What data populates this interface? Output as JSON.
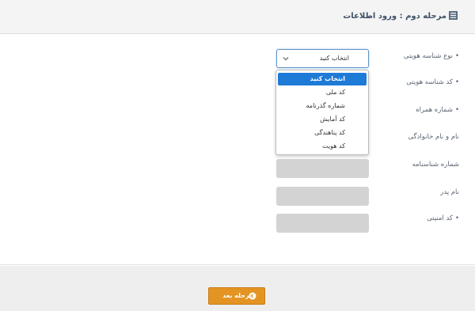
{
  "header": {
    "title": "مرحله دوم : ورود اطلاعات",
    "icon": "list-icon"
  },
  "form": {
    "fields": [
      {
        "label": "نوع شناسه هویتی",
        "required": "•"
      },
      {
        "label": "کد شناسه هویتی",
        "required": "•"
      },
      {
        "label": "شماره همراه",
        "required": "•"
      },
      {
        "label": "نام و نام خانوادگی",
        "required": ""
      },
      {
        "label": "شماره شناسنامه",
        "required": ""
      },
      {
        "label": "نام پدر",
        "required": ""
      },
      {
        "label": "کد امنیتی",
        "required": "•"
      }
    ],
    "id_type_select": {
      "value": "انتخاب کنید",
      "options": [
        "انتخاب کنید",
        "کد ملی",
        "شماره گذرنامه",
        "کد آمایش",
        "کد پناهندگی",
        "کد هویت"
      ]
    }
  },
  "footer": {
    "next_label": "مرحله بعد",
    "next_icon": "arrow-circle-icon"
  },
  "colors": {
    "accent": "#1e7ad7",
    "button": "#e39423",
    "title": "#3e4f67"
  }
}
